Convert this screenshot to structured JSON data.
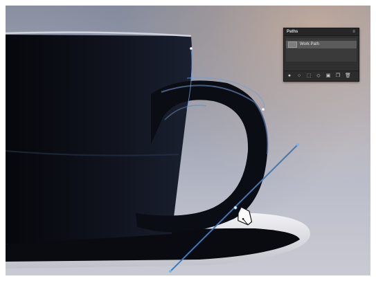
{
  "panel": {
    "tab_label": "Paths",
    "menu_icon": "panel-menu-icon",
    "path_item": {
      "name": "Work Path",
      "thumbnail_icon": "path-thumbnail-icon"
    },
    "footer_icons": [
      "fill-path-icon",
      "stroke-path-icon",
      "load-selection-icon",
      "make-work-path-icon",
      "add-mask-icon",
      "new-path-icon",
      "delete-path-icon"
    ]
  },
  "canvas": {
    "tool": "pen-tool-cursor-icon",
    "colors": {
      "cup": "#0c0e16",
      "path_line": "#3f79b8",
      "saucer": "#e4e4e8",
      "panel_bg": "#2f2f2f"
    }
  }
}
